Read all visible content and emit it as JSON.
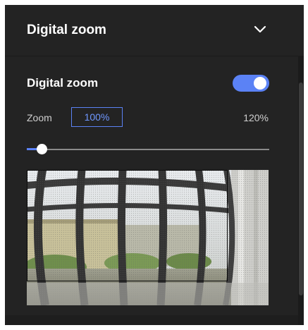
{
  "header": {
    "title": "Digital zoom",
    "collapse_icon": "chevron-down-icon"
  },
  "digital_zoom": {
    "label": "Digital zoom",
    "enabled": true,
    "zoom_label": "Zoom",
    "zoom_value": "100%",
    "zoom_max": "120%",
    "slider_fraction": 0.06
  },
  "colors": {
    "accent": "#5b82f5",
    "panel_bg": "#232323",
    "text": "#ffffff"
  }
}
